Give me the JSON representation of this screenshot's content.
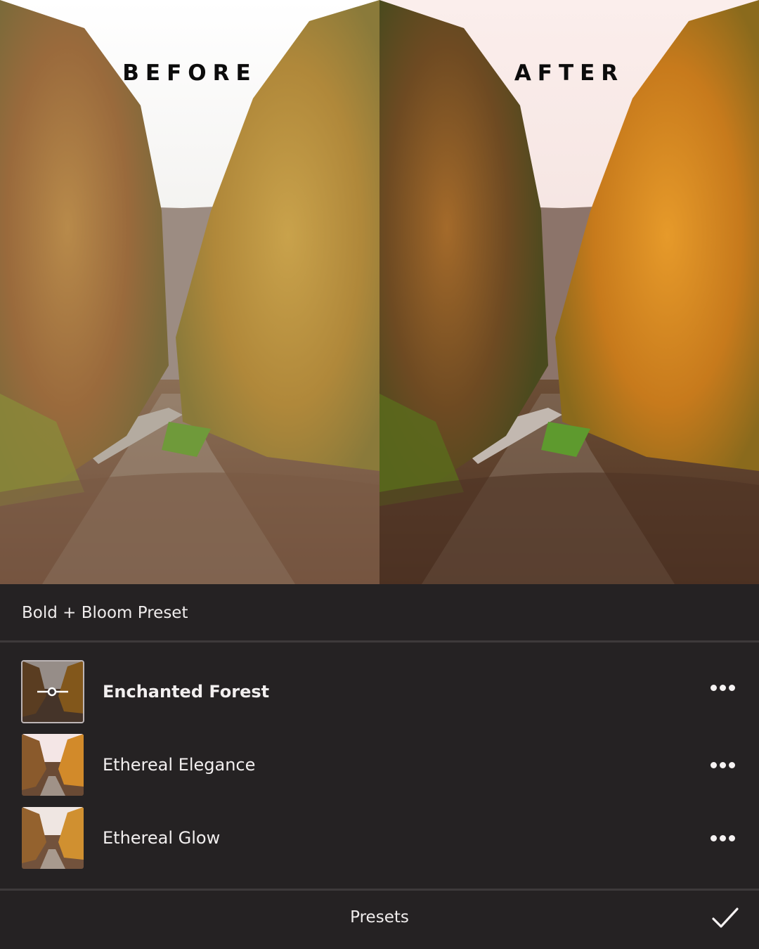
{
  "comparison": {
    "before_label": "BEFORE",
    "after_label": "AFTER"
  },
  "panel": {
    "collection_title": "Bold + Bloom Preset",
    "presets": [
      {
        "name": "Enchanted Forest",
        "selected": true,
        "thumb_icon": "adjust-slider-icon"
      },
      {
        "name": "Ethereal Elegance",
        "selected": false
      },
      {
        "name": "Ethereal Glow",
        "selected": false
      }
    ],
    "more_icon": "more-horizontal-icon",
    "bottom_label": "Presets",
    "confirm_icon": "checkmark-icon"
  },
  "colors": {
    "panel_background": "#252223",
    "text": "#f1eeee",
    "divider": "#3e3a3b"
  }
}
